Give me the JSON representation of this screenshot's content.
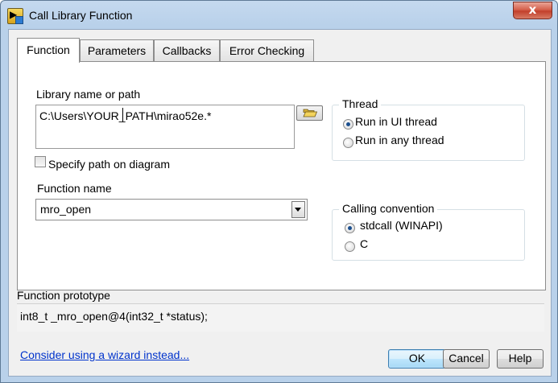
{
  "window": {
    "title": "Call Library Function",
    "icon": "labview-icon",
    "close_symbol": "x"
  },
  "tabs": [
    {
      "label": "Function",
      "active": true
    },
    {
      "label": "Parameters",
      "active": false
    },
    {
      "label": "Callbacks",
      "active": false
    },
    {
      "label": "Error Checking",
      "active": false
    }
  ],
  "function_tab": {
    "library_label": "Library name or path",
    "library_value": "C:\\Users\\YOUR_PATH\\mirao52e.*",
    "browse_icon": "folder-open-icon",
    "specify_path_label": "Specify path on diagram",
    "specify_path_checked": false,
    "function_name_label": "Function name",
    "function_name_value": "mro_open",
    "thread": {
      "title": "Thread",
      "options": [
        "Run in UI thread",
        "Run in any thread"
      ],
      "selected": "Run in UI thread"
    },
    "calling_convention": {
      "title": "Calling convention",
      "options": [
        "stdcall (WINAPI)",
        "C"
      ],
      "selected": "stdcall (WINAPI)"
    }
  },
  "prototype": {
    "title": "Function prototype",
    "value": "int8_t _mro_open@4(int32_t *status);"
  },
  "footer": {
    "wizard_link": "Consider using a wizard instead...",
    "ok": "OK",
    "cancel": "Cancel",
    "help": "Help"
  }
}
